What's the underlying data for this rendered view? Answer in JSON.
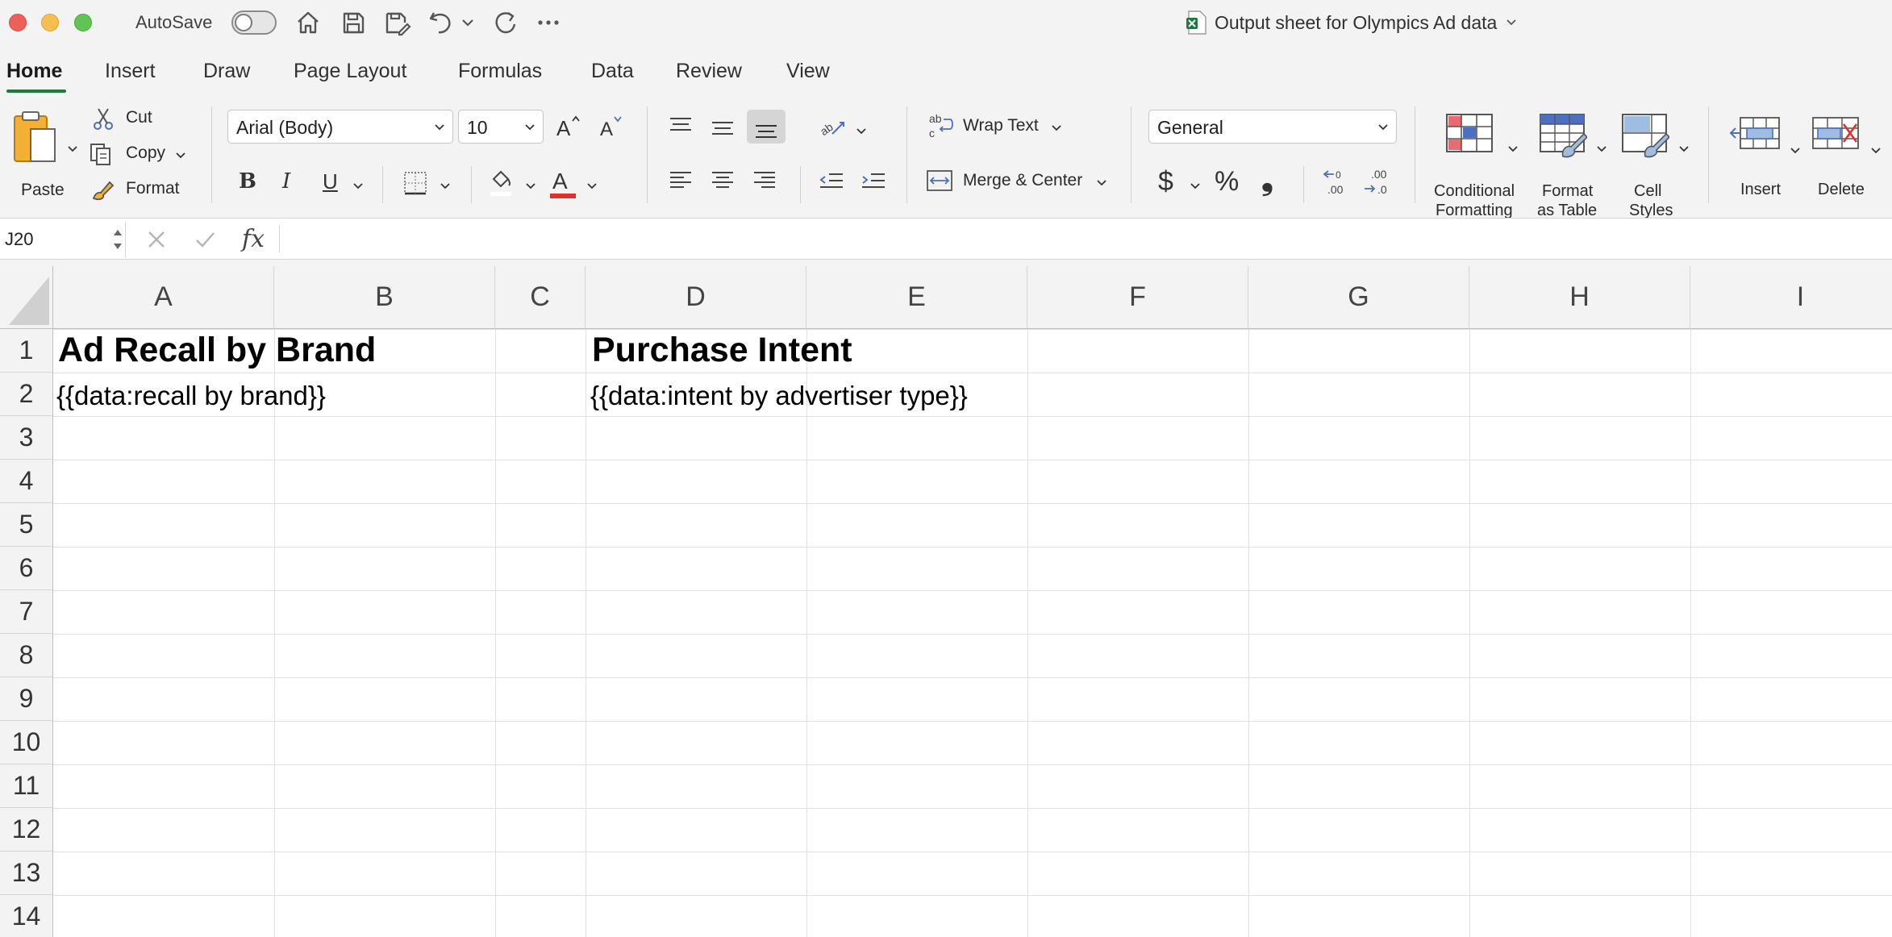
{
  "titlebar": {
    "autosave_label": "AutoSave",
    "autosave_on": false,
    "document_title": "Output sheet for Olympics Ad data"
  },
  "tabs": [
    {
      "label": "Home",
      "active": true
    },
    {
      "label": "Insert"
    },
    {
      "label": "Draw"
    },
    {
      "label": "Page Layout"
    },
    {
      "label": "Formulas"
    },
    {
      "label": "Data"
    },
    {
      "label": "Review"
    },
    {
      "label": "View"
    }
  ],
  "ribbon": {
    "paste_label": "Paste",
    "cut_label": "Cut",
    "copy_label": "Copy",
    "format_label": "Format",
    "font_name": "Arial (Body)",
    "font_size": "10",
    "bold": "B",
    "italic": "I",
    "underline": "U",
    "wrap_text_label": "Wrap Text",
    "merge_center_label": "Merge & Center",
    "number_format": "General",
    "currency": "$",
    "percent": "%",
    "comma": "❟",
    "conditional_formatting_label_1": "Conditional",
    "conditional_formatting_label_2": "Formatting",
    "format_as_table_label_1": "Format",
    "format_as_table_label_2": "as Table",
    "cell_styles_label_1": "Cell",
    "cell_styles_label_2": "Styles",
    "insert_label": "Insert",
    "delete_label": "Delete",
    "font_color": "#e0302b"
  },
  "formula_bar": {
    "name_box": "J20",
    "fx_label": "fx",
    "content": ""
  },
  "grid": {
    "columns": [
      "A",
      "B",
      "C",
      "D",
      "E",
      "F",
      "G",
      "H",
      "I"
    ],
    "rows": [
      "1",
      "2",
      "3",
      "4",
      "5",
      "6",
      "7",
      "8",
      "9",
      "10",
      "11",
      "12",
      "13",
      "14"
    ],
    "cells": {
      "A1": "Ad Recall by Brand",
      "A2": "{{data:recall by brand}}",
      "D1": "Purchase Intent",
      "D2": "{{data:intent by advertiser type}}"
    }
  }
}
